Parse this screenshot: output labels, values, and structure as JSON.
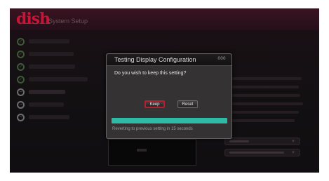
{
  "app": {
    "logo_text": "dish",
    "screen_title": "System Setup"
  },
  "colors": {
    "brand": "#c81537",
    "progress": "#2dbaa6",
    "focus_border": "#b3202f"
  },
  "steps": [
    {
      "icon": "checkmark-icon",
      "state": "done"
    },
    {
      "icon": "checkmark-icon",
      "state": "done"
    },
    {
      "icon": "checkmark-icon",
      "state": "done"
    },
    {
      "icon": "checkmark-icon",
      "state": "done"
    },
    {
      "icon": "minus-circle-icon",
      "state": "current"
    },
    {
      "icon": "minus-circle-icon",
      "state": "pending"
    },
    {
      "icon": "minus-circle-icon",
      "state": "pending"
    }
  ],
  "dialog": {
    "title": "Testing Display Configuration",
    "badge": "000",
    "question": "Do you wish to keep this setting?",
    "keep_label": "Keep",
    "reset_label": "Reset",
    "progress_fraction": 1.0,
    "revert_message": "Reverting to previous setting in 15 seconds"
  }
}
